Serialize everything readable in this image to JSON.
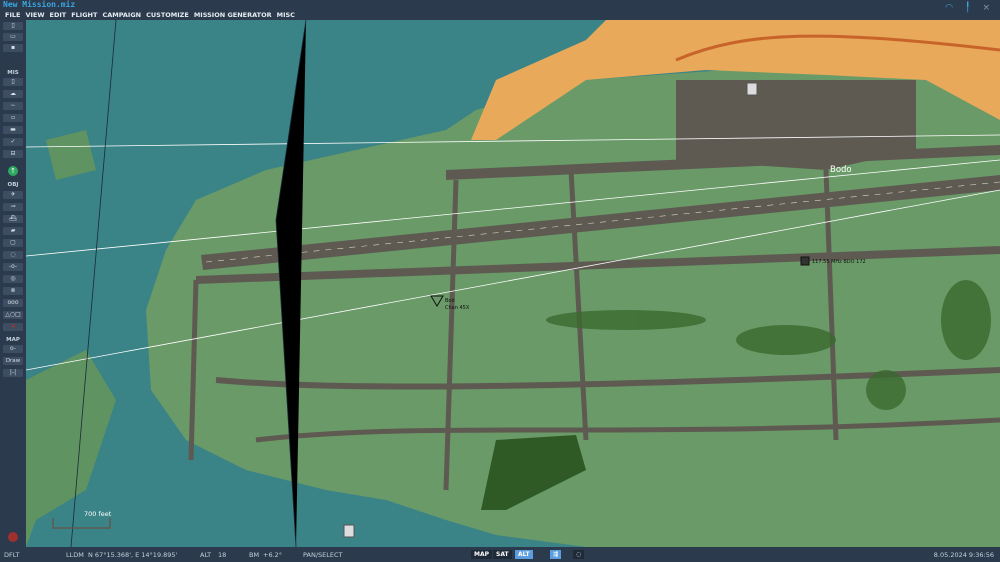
{
  "window": {
    "title": "New Mission.miz",
    "close_icon": "close-icon",
    "wifi_icon": "wifi-icon",
    "signal_icon": "antenna-icon"
  },
  "menu": [
    "FILE",
    "VIEW",
    "EDIT",
    "FLIGHT",
    "CAMPAIGN",
    "CUSTOMIZE",
    "MISSION GENERATOR",
    "MISC"
  ],
  "toolbar": {
    "mis_label": "MIS",
    "obj_label": "OBJ",
    "map_label": "MAP",
    "draw_label": "Draw",
    "file_icons": [
      "new-file-icon",
      "open-folder-icon",
      "save-icon"
    ],
    "mis_icons": [
      "briefing-icon",
      "weather-icon",
      "triggers-icon",
      "trigger-zone-icon",
      "goals-icon",
      "check-icon",
      "mission-tasks-icon"
    ],
    "obj_icons": [
      "plane-icon",
      "helicopter-icon",
      "ship-icon",
      "tank-icon",
      "static-object-icon",
      "template-icon",
      "waypoint-icon",
      "nav-target-icon",
      "point-icon",
      "group-icon",
      "shapes-icon",
      "delete-icon"
    ],
    "map_icons": [
      "map-options-icon",
      "ruler-icon"
    ]
  },
  "map": {
    "city_label": "Bodo",
    "tacan_label_1": "Bod",
    "tacan_label_2": "Chan 45X",
    "vor_label": "117.55 MHz BDO 172",
    "scale_label": "700 feet",
    "colors": {
      "water": "#3a8387",
      "land": "#6a9a68",
      "urban": "#e8a95a",
      "road": "#5e5a52",
      "forest": "#2f5a26"
    }
  },
  "status": {
    "profile": "DFLT",
    "coord_mode": "LLDM",
    "coords": "N 67°15.368', E 14°19.895'",
    "alt_label": "ALT",
    "alt_value": "18",
    "bm_label": "BM",
    "bm_value": "+6.2°",
    "mode": "PAN/SELECT",
    "map_btn": "MAP",
    "sat_btn": "SAT",
    "alt_btn": "ALT",
    "datetime": "8.05.2024 9:36:56"
  }
}
